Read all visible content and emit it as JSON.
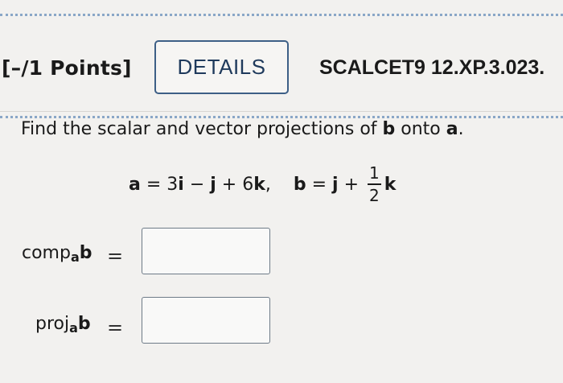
{
  "header": {
    "points": "[–/1 Points]",
    "details_button": "DETAILS",
    "problem_code": "SCALCET9 12.XP.3.023."
  },
  "question": {
    "prompt_pre": "Find the scalar and vector projections of ",
    "prompt_b": "b",
    "prompt_mid": " onto ",
    "prompt_a": "a",
    "prompt_end": ".",
    "equation": {
      "a_name": "a",
      "a_rhs_1": " = 3",
      "i": "i",
      "a_rhs_2": " − ",
      "j": "j",
      "a_rhs_3": " + 6",
      "k": "k",
      "sep": ",",
      "b_name": "b",
      "b_rhs_1": " = ",
      "b_j": "j",
      "b_rhs_2": " + ",
      "frac_num": "1",
      "frac_den": "2",
      "b_k": "k"
    }
  },
  "answers": {
    "comp": {
      "prefix": "comp",
      "sub": "a",
      "vec": "b",
      "eq": "=",
      "value": ""
    },
    "proj": {
      "prefix": "proj",
      "sub": "a",
      "vec": "b",
      "eq": "=",
      "value": ""
    }
  }
}
